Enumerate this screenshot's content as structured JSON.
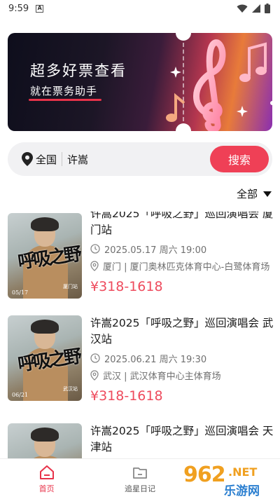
{
  "status_bar": {
    "time": "9:59",
    "notification_icon_letter": "A",
    "icons": [
      "wifi-icon",
      "cell-signal-icon",
      "battery-icon"
    ]
  },
  "banner": {
    "title": "超多好票查看",
    "subtitle": "就在票务助手",
    "accent_color": "#e8334a"
  },
  "search": {
    "location_label": "全国",
    "query_value": "许嵩",
    "placeholder": "",
    "button_label": "搜索",
    "button_color": "#ef4056"
  },
  "filter": {
    "label": "全部"
  },
  "events": [
    {
      "title": "许嵩2025「呼吸之野」巡回演唱会 厦门站",
      "datetime": "2025.05.17 周六 19:00",
      "venue": "厦门 | 厦门奥林匹克体育中心-白鹭体育场",
      "price": "¥318-1618",
      "poster_date": "05/17",
      "poster_city": "厦门站"
    },
    {
      "title": "许嵩2025「呼吸之野」巡回演唱会 武汉站",
      "datetime": "2025.06.21 周六 19:30",
      "venue": "武汉 | 武汉体育中心主体育场",
      "price": "¥318-1618",
      "poster_date": "06/21",
      "poster_city": "武汉站"
    },
    {
      "title": "许嵩2025「呼吸之野」巡回演唱会 天津站",
      "datetime": "",
      "venue": "",
      "price": "",
      "poster_date": "",
      "poster_city": ""
    }
  ],
  "poster_calligraphy": "呼吸之野",
  "price_color": "#ee4b5d",
  "bottom_nav": [
    {
      "label": "首页",
      "icon": "home-icon",
      "active": true
    },
    {
      "label": "追星日记",
      "icon": "folder-icon",
      "active": false
    }
  ],
  "watermark": {
    "number": "962",
    "suffix": ".NET",
    "text": "乐游网"
  }
}
